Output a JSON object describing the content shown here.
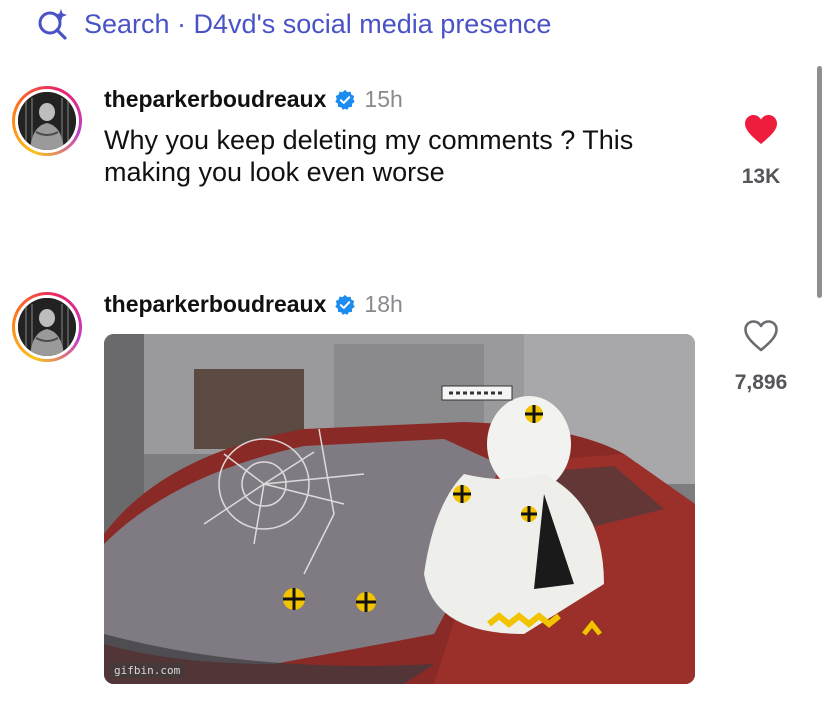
{
  "search": {
    "icon": "search-sparkle-icon",
    "text": "Search · D4vd's social media presence",
    "color": "#4a52c7"
  },
  "comments": [
    {
      "username": "theparkerboudreaux",
      "verified": true,
      "timestamp": "15h",
      "text": "Why you keep deleting my comments ? This making you look even worse",
      "liked": true,
      "like_icon": "heart-filled-icon",
      "like_count": "13K"
    },
    {
      "username": "theparkerboudreaux",
      "verified": true,
      "timestamp": "18h",
      "media": "crash-test-dummy-gif",
      "media_watermark": "gifbin.com",
      "liked": false,
      "like_icon": "heart-outline-icon",
      "like_count": "7,896"
    }
  ],
  "colors": {
    "accent": "#4a52c7",
    "verified": "#1d8cf0",
    "heart": "#ee1d3e",
    "muted": "#8a8a8e"
  }
}
